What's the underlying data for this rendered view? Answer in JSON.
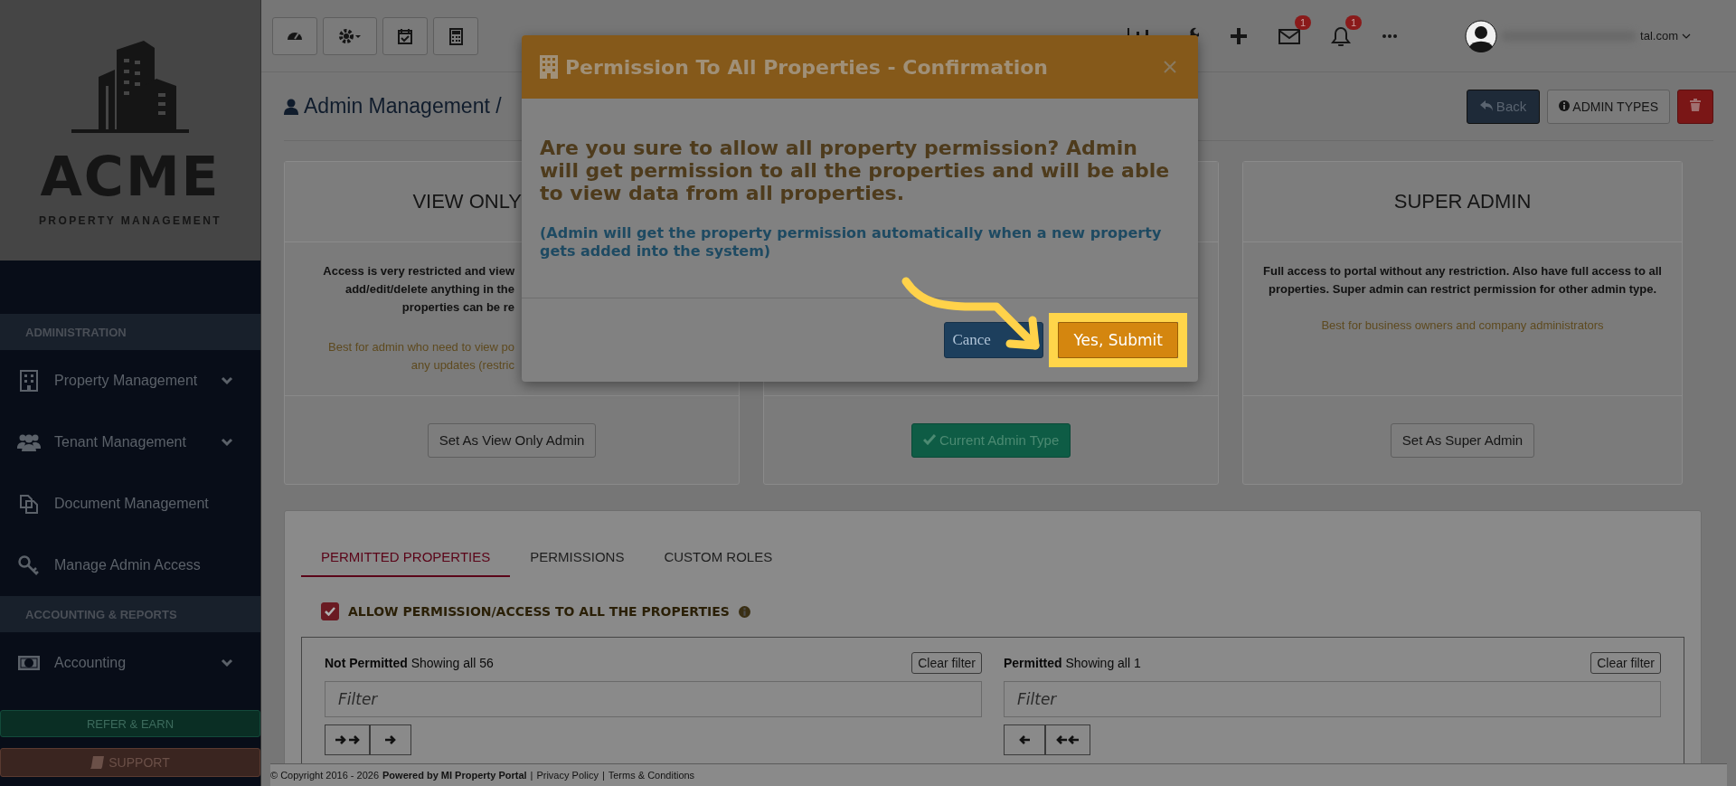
{
  "sidebar": {
    "logo": {
      "name": "ACME",
      "tagline": "PROPERTY MANAGEMENT"
    },
    "sections": [
      {
        "heading": "ADMINISTRATION",
        "items": [
          {
            "label": "Property Management",
            "kind": "menu"
          },
          {
            "label": "Tenant Management",
            "kind": "menu"
          },
          {
            "label": "Document Management",
            "kind": "link"
          },
          {
            "label": "Manage Admin Access",
            "kind": "link"
          }
        ]
      },
      {
        "heading": "ACCOUNTING & REPORTS",
        "items": [
          {
            "label": "Accounting",
            "kind": "menu"
          }
        ]
      }
    ],
    "refer_button": "REFER & EARN",
    "support_button": "SUPPORT"
  },
  "top_bar": {
    "mail_badge": "1",
    "bell_badge": "1",
    "user_email": "tal.com"
  },
  "header": {
    "title": "Admin Management /",
    "back_button": "Back",
    "types_button": "ADMIN TYPES"
  },
  "cards": [
    {
      "kind": "option",
      "title": "VIEW ONLY",
      "description_lines": [
        "Access is very restricted and view",
        "add/edit/delete anything in the",
        "properties can be re"
      ],
      "note_lines": [
        "Best for admin who need to view po",
        "any updates (restric"
      ],
      "button": "Set As View Only Admin"
    },
    {
      "kind": "current",
      "button": "Current Admin Type"
    },
    {
      "kind": "option",
      "title": "SUPER ADMIN",
      "description": "Full access to portal without any restriction. Also have full access to all properties. Super admin can restrict permission for other admin type.",
      "note": "Best for business owners and company administrators",
      "button": "Set As Super Admin"
    }
  ],
  "tabs": [
    {
      "label": "PERMITTED PROPERTIES",
      "selected": true
    },
    {
      "label": "PERMISSIONS",
      "selected": false
    },
    {
      "label": "CUSTOM ROLES",
      "selected": false
    }
  ],
  "allow_all": {
    "label": "ALLOW PERMISSION/ACCESS TO ALL THE PROPERTIES",
    "checked": true
  },
  "lists": [
    {
      "kind": "source",
      "title": "Not Permitted",
      "count": "Showing all 56",
      "clear_button": "Clear filter",
      "placeholder": "Filter"
    },
    {
      "kind": "target",
      "title": "Permitted",
      "count": "Showing all 1",
      "clear_button": "Clear filter",
      "placeholder": "Filter"
    }
  ],
  "footer": {
    "copyright": "© Copyright 2016 - 2026",
    "powered": "Powered by MI Property Portal",
    "separator": "|",
    "links": [
      "Privacy Policy",
      "Terms & Conditions"
    ]
  },
  "modal": {
    "title": "Permission To All Properties - Confirmation",
    "message": "Are you sure to allow all property permission? Admin will get permission to all the properties and will be able to view data from all properties.",
    "note": "(Admin will get the property permission automatically when a new property gets added into the system)",
    "cancel_button": "Cance",
    "submit_button": "Yes, Submit"
  }
}
